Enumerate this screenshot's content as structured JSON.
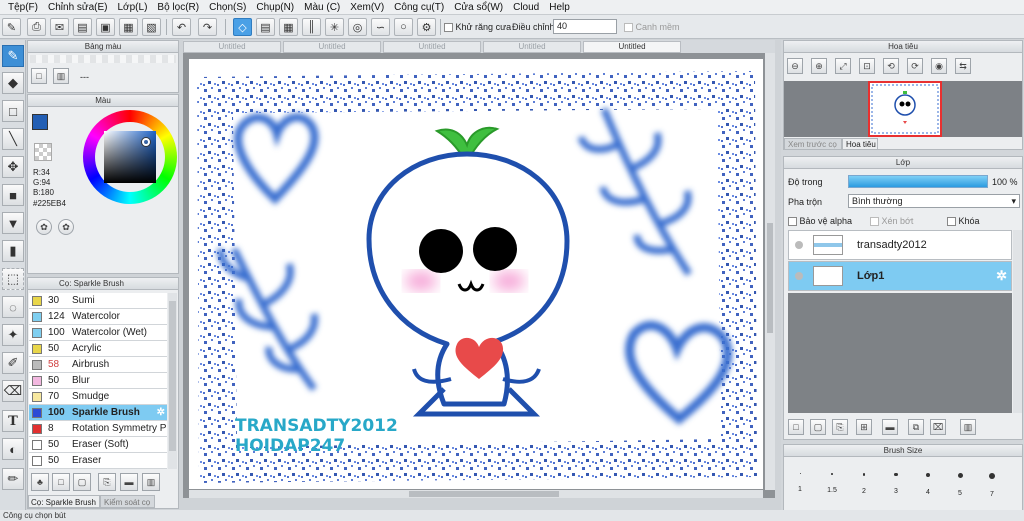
{
  "menu": [
    "Tệp(F)",
    "Chỉnh sửa(E)",
    "Lớp(L)",
    "Bộ lọc(R)",
    "Chọn(S)",
    "Chụp(N)",
    "Màu (C)",
    "Xem(V)",
    "Công cụ(T)",
    "Cửa sổ(W)",
    "Cloud",
    "Help"
  ],
  "toolbar": {
    "antialias_label": "Khử răng cưa",
    "adjust_label": "Điều chỉnh",
    "adjust_value": "40",
    "smooth_label": "Canh mềm"
  },
  "canvas_tabs": [
    "Untitled",
    "Untitled",
    "Untitled",
    "Untitled",
    "Untitled"
  ],
  "swatch_panel": {
    "title": "Bảng màu",
    "dash": "---"
  },
  "color_panel": {
    "title": "Màu",
    "r": "R:34",
    "g": "G:94",
    "b": "B:180",
    "hex": "#225EB4",
    "current_color": "#225EB4"
  },
  "brush_panel": {
    "title": "Cọ: Sparkle Brush",
    "items": [
      {
        "size": "30",
        "name": "Sumi",
        "color": "#e8d64a"
      },
      {
        "size": "124",
        "name": "Watercolor",
        "color": "#7fcff0"
      },
      {
        "size": "100",
        "name": "Watercolor (Wet)",
        "color": "#7fcff0"
      },
      {
        "size": "50",
        "name": "Acrylic",
        "color": "#e8d64a"
      },
      {
        "size": "58",
        "name": "Airbrush",
        "color": "#bbbbbb"
      },
      {
        "size": "50",
        "name": "Blur",
        "color": "#f2b8e0"
      },
      {
        "size": "70",
        "name": "Smudge",
        "color": "#f7e8a0"
      },
      {
        "size": "100",
        "name": "Sparkle Brush",
        "color": "#2c4bd6"
      },
      {
        "size": "8",
        "name": "Rotation Symmetry P",
        "color": "#e23030"
      },
      {
        "size": "50",
        "name": "Eraser (Soft)",
        "color": "#ffffff"
      },
      {
        "size": "50",
        "name": "Eraser",
        "color": "#ffffff"
      }
    ],
    "bottom_tab_1": "Cọ: Sparkle Brush",
    "bottom_tab_2": "Kiểm soát cọ"
  },
  "artwork": {
    "text_line1": "TRANSADTY2012",
    "text_line2": "HOIDAP247"
  },
  "navigator": {
    "title": "Hoa tiêu",
    "tab_preview": "Xem trước cọ",
    "tab_nav": "Hoa tiêu"
  },
  "layer_panel": {
    "title": "Lớp",
    "opacity_label": "Độ trong",
    "opacity_value": "100 %",
    "blend_label": "Pha trộn",
    "blend_value": "Bình thường",
    "protect_alpha": "Bảo vệ alpha",
    "clipping": "Xén bớt",
    "lock": "Khóa",
    "layers": [
      {
        "name": "transadty2012"
      },
      {
        "name": "Lớp1"
      }
    ]
  },
  "brush_size_panel": {
    "title": "Brush Size",
    "sizes": [
      "1",
      "1.5",
      "2",
      "3",
      "4",
      "5",
      "7"
    ]
  },
  "status_text": "Công cụ chọn bút"
}
